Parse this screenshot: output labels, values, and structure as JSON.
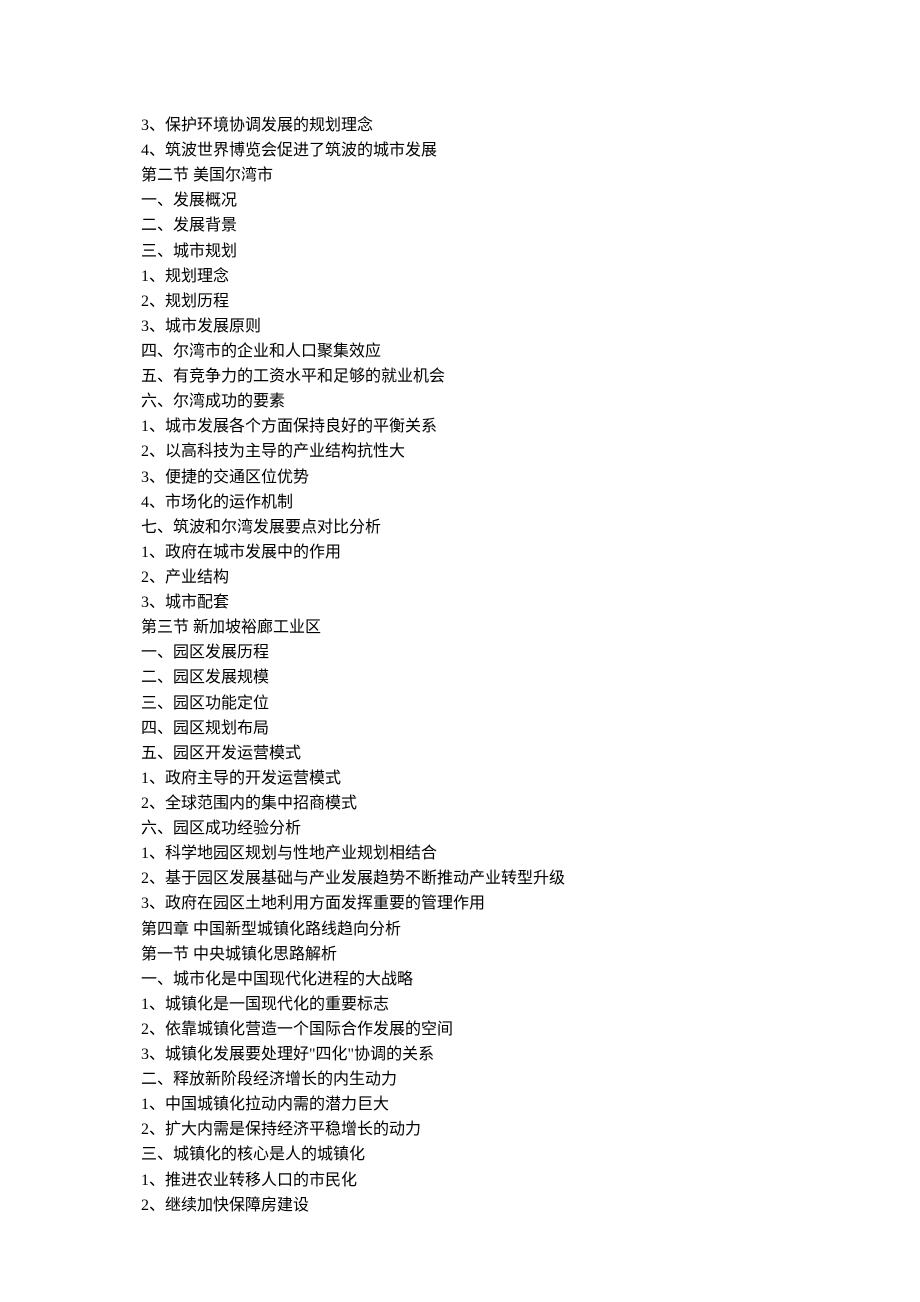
{
  "lines": [
    "3、保护环境协调发展的规划理念",
    "4、筑波世界博览会促进了筑波的城市发展",
    "第二节  美国尔湾市",
    "一、发展概况",
    "二、发展背景",
    "三、城市规划",
    "1、规划理念",
    "2、规划历程",
    "3、城市发展原则",
    "四、尔湾市的企业和人口聚集效应",
    "五、有竞争力的工资水平和足够的就业机会",
    "六、尔湾成功的要素",
    "1、城市发展各个方面保持良好的平衡关系",
    "2、以高科技为主导的产业结构抗性大",
    "3、便捷的交通区位优势",
    "4、市场化的运作机制",
    "七、筑波和尔湾发展要点对比分析",
    "1、政府在城市发展中的作用",
    "2、产业结构",
    "3、城市配套",
    "第三节  新加坡裕廊工业区",
    "一、园区发展历程",
    "二、园区发展规模",
    "三、园区功能定位",
    "四、园区规划布局",
    "五、园区开发运营模式",
    "1、政府主导的开发运营模式",
    "2、全球范围内的集中招商模式",
    "六、园区成功经验分析",
    "1、科学地园区规划与性地产业规划相结合",
    "2、基于园区发展基础与产业发展趋势不断推动产业转型升级",
    "3、政府在园区土地利用方面发挥重要的管理作用",
    "第四章  中国新型城镇化路线趋向分析",
    "第一节  中央城镇化思路解析",
    "一、城市化是中国现代化进程的大战略",
    "1、城镇化是一国现代化的重要标志",
    "2、依靠城镇化营造一个国际合作发展的空间",
    "3、城镇化发展要处理好\"四化\"协调的关系",
    "二、释放新阶段经济增长的内生动力",
    "1、中国城镇化拉动内需的潜力巨大",
    "2、扩大内需是保持经济平稳增长的动力",
    "三、城镇化的核心是人的城镇化",
    "1、推进农业转移人口的市民化",
    "2、继续加快保障房建设"
  ]
}
